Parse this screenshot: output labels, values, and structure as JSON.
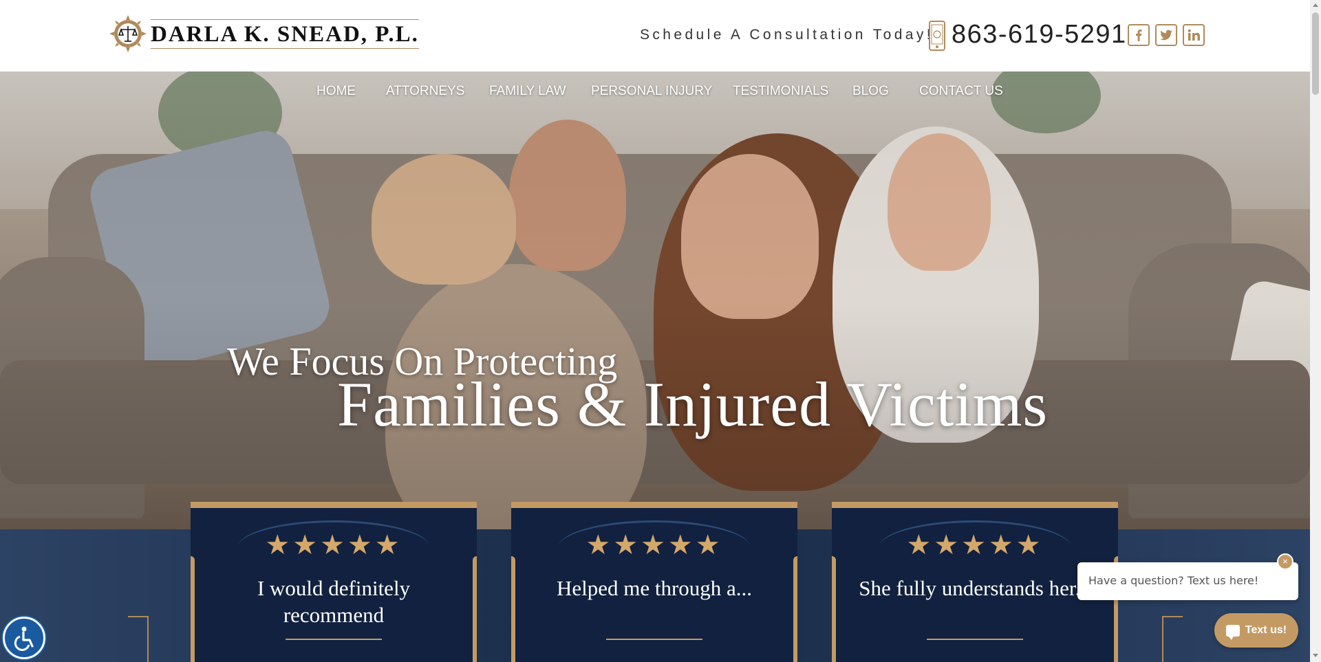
{
  "header": {
    "logo_text": "DARLA K. SNEAD, P.L.",
    "cta": "Schedule A Consultation Today!",
    "phone": "863-619-5291",
    "social": [
      {
        "name": "facebook",
        "icon": "facebook-icon"
      },
      {
        "name": "twitter",
        "icon": "twitter-icon"
      },
      {
        "name": "linkedin",
        "icon": "linkedin-icon"
      }
    ]
  },
  "nav": {
    "items": [
      "HOME",
      "ATTORNEYS",
      "FAMILY LAW",
      "PERSONAL INJURY",
      "TESTIMONIALS",
      "BLOG",
      "CONTACT US"
    ]
  },
  "hero": {
    "line1": "We Focus On Protecting",
    "line2": "Families & Injured Victims"
  },
  "testimonials": [
    {
      "stars": "★★★★★",
      "quote": "I would definitely recommend"
    },
    {
      "stars": "★★★★★",
      "quote": "Helped me through a..."
    },
    {
      "stars": "★★★★★",
      "quote": "She fully understands her..."
    }
  ],
  "chat": {
    "placeholder": "Have a question? Text us here!",
    "close": "×",
    "button": "Text us!"
  },
  "colors": {
    "accent_gold": "#c49a64",
    "navy": "#11213f",
    "accessibility_blue": "#1a5aa0"
  }
}
